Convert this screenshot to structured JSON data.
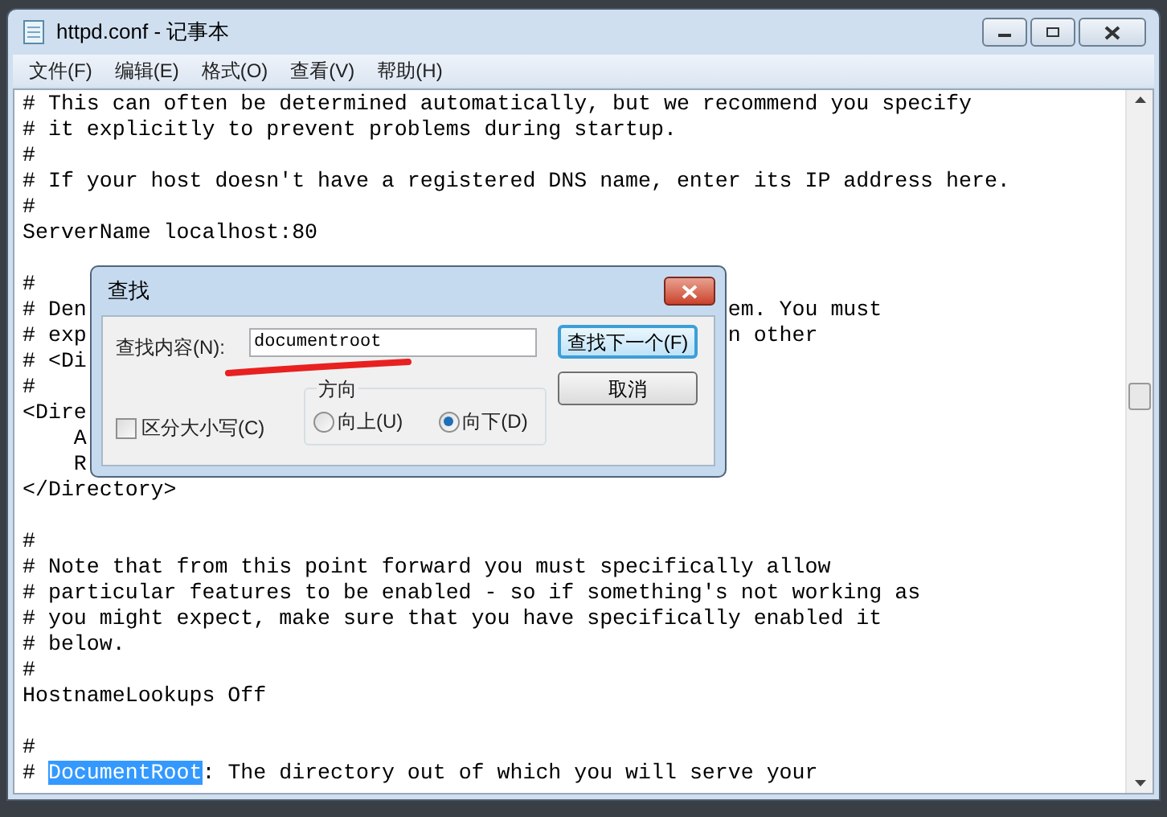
{
  "window": {
    "title": "httpd.conf - 记事本"
  },
  "menu": [
    "文件(F)",
    "编辑(E)",
    "格式(O)",
    "查看(V)",
    "帮助(H)"
  ],
  "lines": [
    {
      "text": "# This can often be determined automatically, but we recommend you specify"
    },
    {
      "text": "# it explicitly to prevent problems during startup."
    },
    {
      "text": "#"
    },
    {
      "text": "# If your host doesn't have a registered DNS name, enter its IP address here."
    },
    {
      "text": "#"
    },
    {
      "text": "ServerName localhost:80"
    },
    {
      "text": "#",
      "gap_before": true
    },
    {
      "text": "# Den",
      "right": "em. You must"
    },
    {
      "text": "# exp",
      "right": "n other"
    },
    {
      "text": "# <Di"
    },
    {
      "text": "#"
    },
    {
      "text": "<Dire"
    },
    {
      "text": "    A"
    },
    {
      "text": "    R"
    },
    {
      "text": "</Directory>"
    },
    {
      "text": "#",
      "gap_before": true
    },
    {
      "text": "# Note that from this point forward you must specifically allow"
    },
    {
      "text": "# particular features to be enabled - so if something's not working as"
    },
    {
      "text": "# you might expect, make sure that you have specifically enabled it"
    },
    {
      "text": "# below."
    },
    {
      "text": "#"
    },
    {
      "text": "HostnameLookups Off"
    },
    {
      "text": "#",
      "gap_before": true
    },
    {
      "text": "# ",
      "highlight": "DocumentRoot",
      "rest": ": The directory out of which you will serve your"
    }
  ],
  "dialog": {
    "title": "查找",
    "find_label": "查找内容(N):",
    "find_value": "documentroot",
    "find_next": "查找下一个(F)",
    "cancel": "取消",
    "match_case": {
      "label": "区分大小写(C)",
      "checked": false
    },
    "direction": {
      "label": "方向",
      "options": [
        {
          "label": "向上(U)",
          "selected": false
        },
        {
          "label": "向下(D)",
          "selected": true
        }
      ]
    }
  }
}
